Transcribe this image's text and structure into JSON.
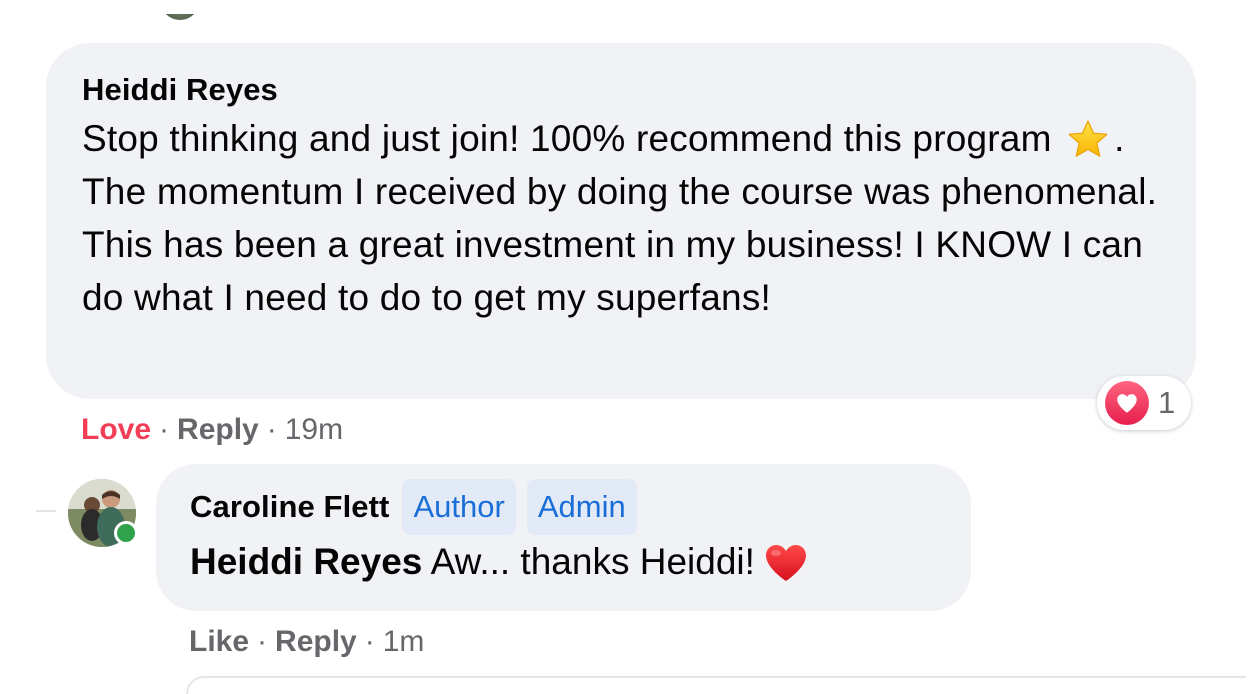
{
  "comment": {
    "author": "Heiddi Reyes",
    "text_before_emoji": "Stop thinking and just join! 100% recommend this program",
    "emoji_icon": "star-icon",
    "text_after_emoji": ". The momentum I received by doing the course was phenomenal. This has been a great investment in my business! I KNOW I can do what I need to do to get my superfans!",
    "reaction": {
      "icon": "love-reaction-icon",
      "count": "1"
    },
    "actions": {
      "love_label": "Love",
      "reply_label": "Reply",
      "separator": "·",
      "time": "19m"
    }
  },
  "reply": {
    "author": "Caroline Flett",
    "badges": [
      "Author",
      "Admin"
    ],
    "mention": "Heiddi Reyes",
    "text": "Aw... thanks Heiddi!",
    "emoji_icon": "red-heart-icon",
    "online": true,
    "actions": {
      "like_label": "Like",
      "reply_label": "Reply",
      "separator": "·",
      "time": "1m"
    }
  },
  "colors": {
    "bubble_bg": "#f0f2f5",
    "love_red": "#f33e58",
    "badge_bg": "#e3eaf7",
    "badge_text": "#1a6ed8",
    "meta_gray": "#65676b",
    "online_green": "#31a24c"
  }
}
